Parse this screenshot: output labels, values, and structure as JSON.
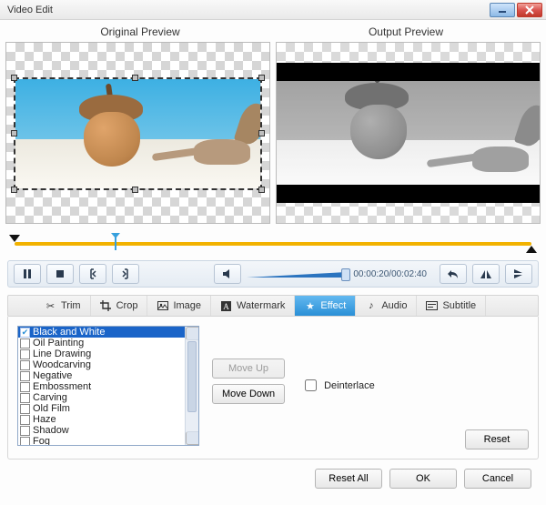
{
  "window": {
    "title": "Video Edit"
  },
  "preview": {
    "original_label": "Original Preview",
    "output_label": "Output Preview"
  },
  "timecode": {
    "display": "00:00:20/00:02:40"
  },
  "tabs": [
    {
      "id": "trim",
      "label": "Trim",
      "icon": "scissors-icon"
    },
    {
      "id": "crop",
      "label": "Crop",
      "icon": "crop-icon"
    },
    {
      "id": "image",
      "label": "Image",
      "icon": "picture-icon"
    },
    {
      "id": "watermark",
      "label": "Watermark",
      "icon": "text-icon"
    },
    {
      "id": "effect",
      "label": "Effect",
      "icon": "star-icon"
    },
    {
      "id": "audio",
      "label": "Audio",
      "icon": "note-icon"
    },
    {
      "id": "subtitle",
      "label": "Subtitle",
      "icon": "subtitle-icon"
    }
  ],
  "active_tab": "effect",
  "effects": {
    "items": [
      {
        "label": "Black and White",
        "checked": true,
        "selected": true
      },
      {
        "label": "Oil Painting",
        "checked": false,
        "selected": false
      },
      {
        "label": "Line Drawing",
        "checked": false,
        "selected": false
      },
      {
        "label": "Woodcarving",
        "checked": false,
        "selected": false
      },
      {
        "label": "Negative",
        "checked": false,
        "selected": false
      },
      {
        "label": "Embossment",
        "checked": false,
        "selected": false
      },
      {
        "label": "Carving",
        "checked": false,
        "selected": false
      },
      {
        "label": "Old Film",
        "checked": false,
        "selected": false
      },
      {
        "label": "Haze",
        "checked": false,
        "selected": false
      },
      {
        "label": "Shadow",
        "checked": false,
        "selected": false
      },
      {
        "label": "Fog",
        "checked": false,
        "selected": false
      }
    ],
    "move_up": "Move Up",
    "move_down": "Move Down",
    "deinterlace_label": "Deinterlace",
    "deinterlace_checked": false,
    "reset": "Reset"
  },
  "footer": {
    "reset_all": "Reset All",
    "ok": "OK",
    "cancel": "Cancel"
  }
}
